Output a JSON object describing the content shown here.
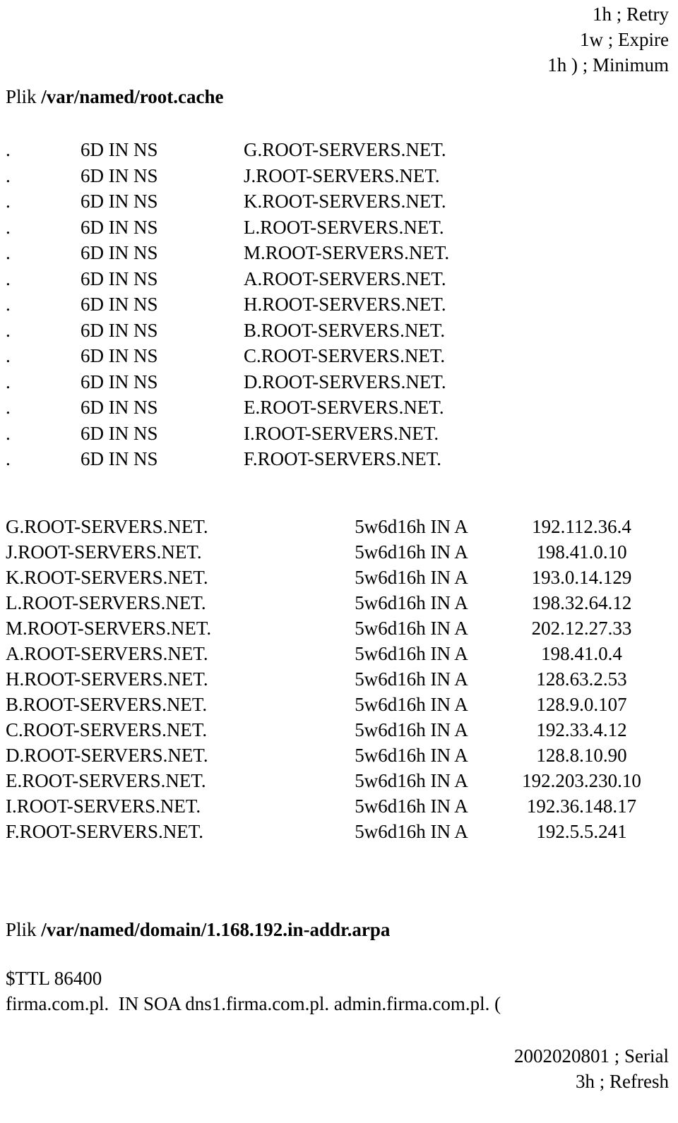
{
  "document": {
    "soa_tail_top": [
      "1h ; Retry",
      "1w ; Expire",
      "1h ) ; Minimum"
    ],
    "sections": [
      {
        "heading_label": "Plik",
        "heading_path": "/var/named/root.cache"
      },
      {
        "heading_label": "Plik",
        "heading_path": "/var/named/domain/1.168.192.in-addr.arpa"
      }
    ],
    "ns_records": [
      {
        "owner": ".",
        "ttl_class_type": "6D IN NS",
        "target": "G.ROOT-SERVERS.NET."
      },
      {
        "owner": ".",
        "ttl_class_type": "6D IN NS",
        "target": "J.ROOT-SERVERS.NET."
      },
      {
        "owner": ".",
        "ttl_class_type": "6D IN NS",
        "target": "K.ROOT-SERVERS.NET."
      },
      {
        "owner": ".",
        "ttl_class_type": "6D IN NS",
        "target": "L.ROOT-SERVERS.NET."
      },
      {
        "owner": ".",
        "ttl_class_type": "6D IN NS",
        "target": "M.ROOT-SERVERS.NET."
      },
      {
        "owner": ".",
        "ttl_class_type": "6D IN NS",
        "target": "A.ROOT-SERVERS.NET."
      },
      {
        "owner": ".",
        "ttl_class_type": "6D IN NS",
        "target": "H.ROOT-SERVERS.NET."
      },
      {
        "owner": ".",
        "ttl_class_type": "6D IN NS",
        "target": "B.ROOT-SERVERS.NET."
      },
      {
        "owner": ".",
        "ttl_class_type": "6D IN NS",
        "target": "C.ROOT-SERVERS.NET."
      },
      {
        "owner": ".",
        "ttl_class_type": "6D IN NS",
        "target": "D.ROOT-SERVERS.NET."
      },
      {
        "owner": ".",
        "ttl_class_type": "6D IN NS",
        "target": "E.ROOT-SERVERS.NET."
      },
      {
        "owner": ".",
        "ttl_class_type": "6D IN NS",
        "target": "I.ROOT-SERVERS.NET."
      },
      {
        "owner": ".",
        "ttl_class_type": "6D IN NS",
        "target": "F.ROOT-SERVERS.NET."
      }
    ],
    "a_records": [
      {
        "name": "G.ROOT-SERVERS.NET.",
        "ttl_class_type": "5w6d16h IN A",
        "address": "192.112.36.4"
      },
      {
        "name": "J.ROOT-SERVERS.NET.",
        "ttl_class_type": "5w6d16h IN A",
        "address": "198.41.0.10"
      },
      {
        "name": "K.ROOT-SERVERS.NET.",
        "ttl_class_type": "5w6d16h IN A",
        "address": "193.0.14.129"
      },
      {
        "name": "L.ROOT-SERVERS.NET.",
        "ttl_class_type": "5w6d16h IN A",
        "address": "198.32.64.12"
      },
      {
        "name": "M.ROOT-SERVERS.NET.",
        "ttl_class_type": "5w6d16h IN A",
        "address": "202.12.27.33"
      },
      {
        "name": "A.ROOT-SERVERS.NET.",
        "ttl_class_type": "5w6d16h IN A",
        "address": "198.41.0.4"
      },
      {
        "name": "H.ROOT-SERVERS.NET.",
        "ttl_class_type": "5w6d16h IN A",
        "address": "128.63.2.53"
      },
      {
        "name": "B.ROOT-SERVERS.NET.",
        "ttl_class_type": "5w6d16h IN A",
        "address": "128.9.0.107"
      },
      {
        "name": "C.ROOT-SERVERS.NET.",
        "ttl_class_type": "5w6d16h IN A",
        "address": "192.33.4.12"
      },
      {
        "name": "D.ROOT-SERVERS.NET.",
        "ttl_class_type": "5w6d16h IN A",
        "address": "128.8.10.90"
      },
      {
        "name": "E.ROOT-SERVERS.NET.",
        "ttl_class_type": "5w6d16h IN A",
        "address": "192.203.230.10"
      },
      {
        "name": "I.ROOT-SERVERS.NET.",
        "ttl_class_type": "5w6d16h IN A",
        "address": "192.36.148.17"
      },
      {
        "name": "F.ROOT-SERVERS.NET.",
        "ttl_class_type": "5w6d16h IN A",
        "address": "192.5.5.241"
      }
    ],
    "reverse_zone_body": [
      "$TTL 86400",
      "firma.com.pl.  IN SOA dns1.firma.com.pl. admin.firma.com.pl. ("
    ],
    "soa_tail_bottom": [
      "2002020801 ; Serial",
      "3h ; Refresh"
    ]
  }
}
